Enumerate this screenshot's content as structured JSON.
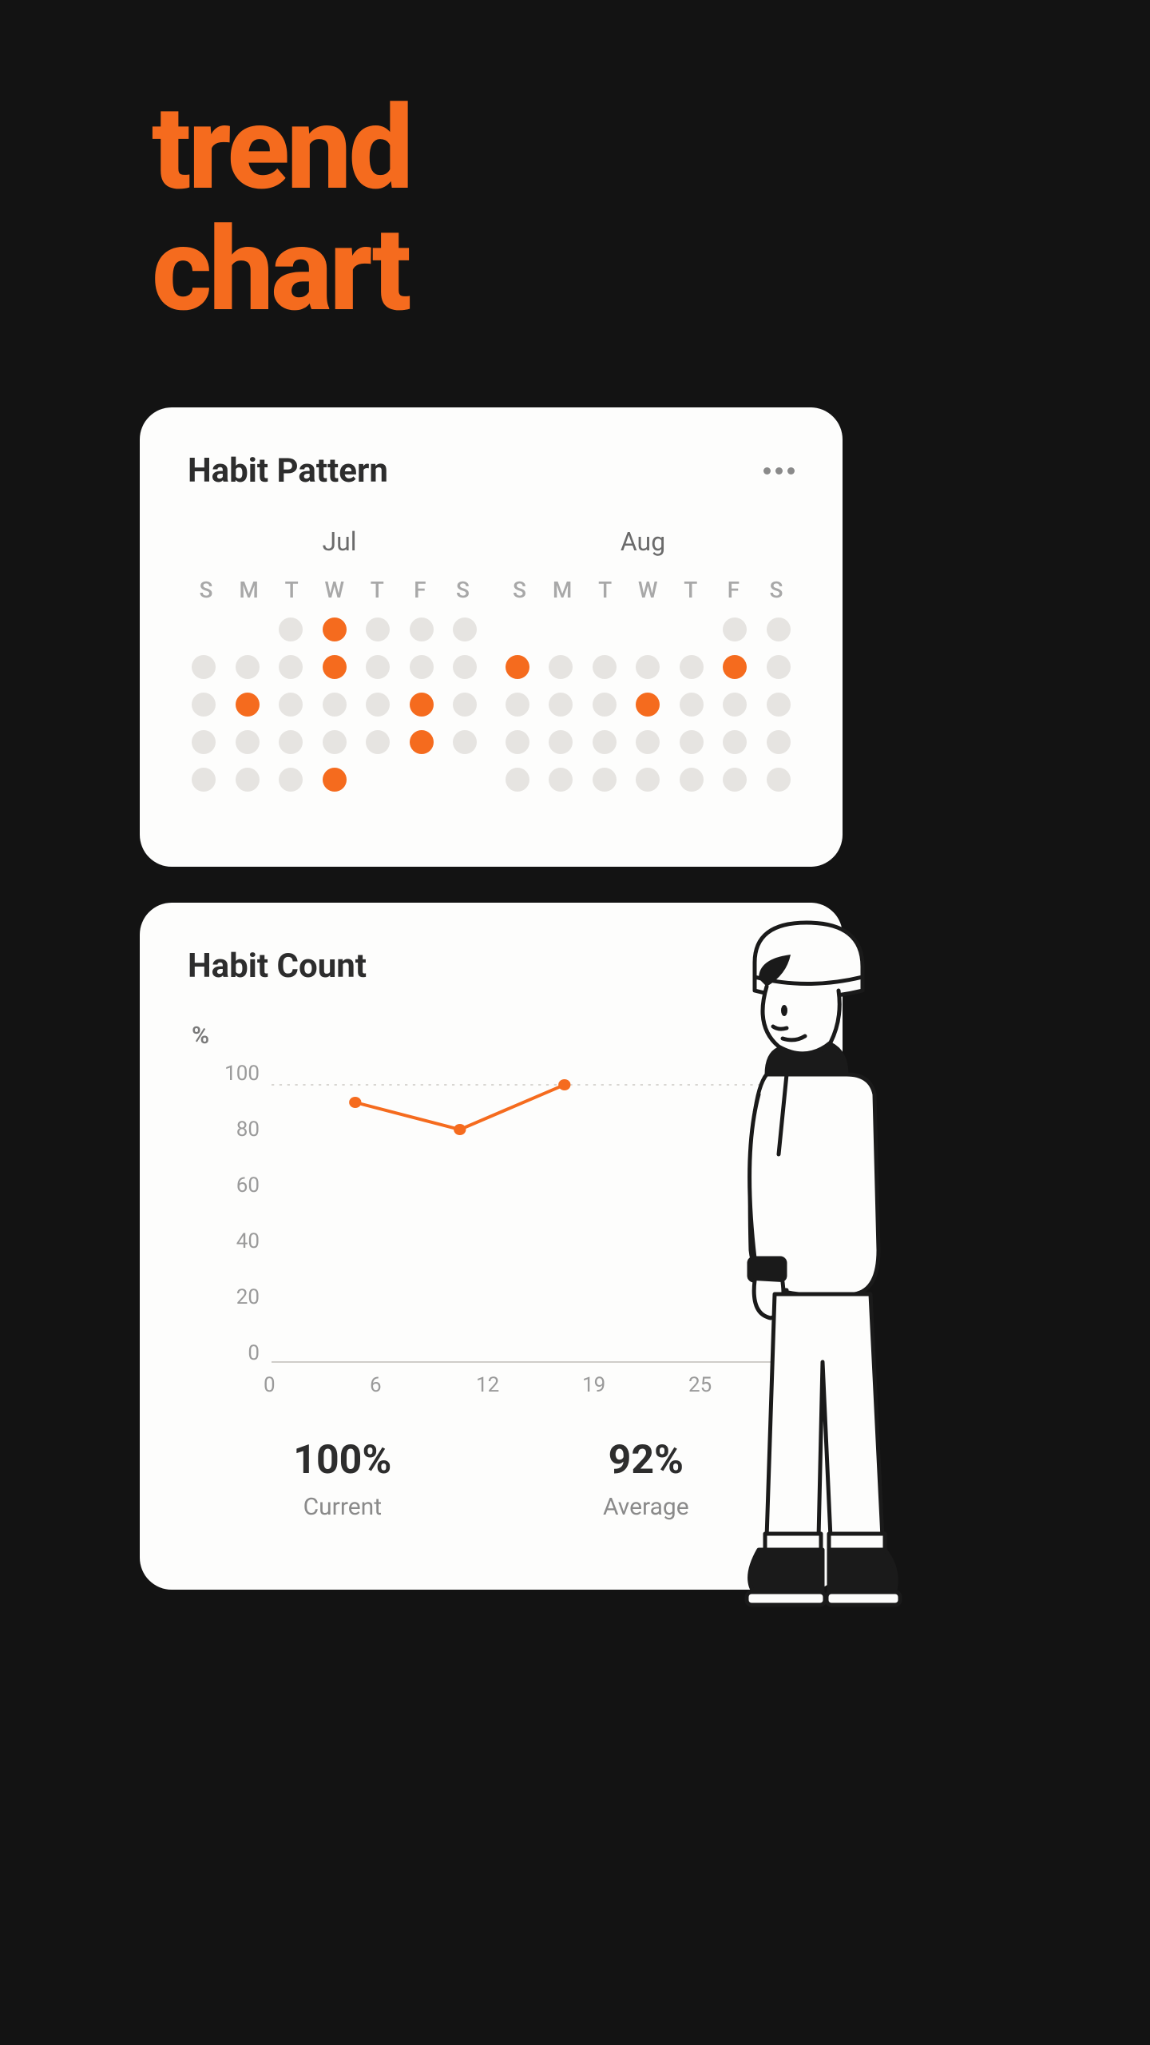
{
  "page": {
    "title_line1": "trend",
    "title_line2": "chart"
  },
  "colors": {
    "accent": "#F56B1E",
    "bg": "#131313",
    "card": "#FDFDFC",
    "dot_off": "#E6E4E1"
  },
  "pattern_card": {
    "title": "Habit Pattern",
    "weekdays": [
      "S",
      "M",
      "T",
      "W",
      "T",
      "F",
      "S"
    ],
    "months": [
      {
        "label": "Jul",
        "grid": [
          [
            "empty",
            "empty",
            "off",
            "on",
            "off",
            "off",
            "off"
          ],
          [
            "off",
            "off",
            "off",
            "on",
            "off",
            "off",
            "off"
          ],
          [
            "off",
            "on",
            "off",
            "off",
            "off",
            "on",
            "off"
          ],
          [
            "off",
            "off",
            "off",
            "off",
            "off",
            "on",
            "off"
          ],
          [
            "off",
            "off",
            "off",
            "on",
            "empty",
            "empty",
            "empty"
          ]
        ]
      },
      {
        "label": "Aug",
        "grid": [
          [
            "empty",
            "empty",
            "empty",
            "empty",
            "empty",
            "off",
            "off"
          ],
          [
            "on",
            "off",
            "off",
            "off",
            "off",
            "on",
            "off"
          ],
          [
            "off",
            "off",
            "off",
            "on",
            "off",
            "off",
            "off"
          ],
          [
            "off",
            "off",
            "off",
            "off",
            "off",
            "off",
            "off"
          ],
          [
            "off",
            "off",
            "off",
            "off",
            "off",
            "off",
            "off"
          ]
        ]
      }
    ]
  },
  "count_card": {
    "title": "Habit Count",
    "unit": "%",
    "y_ticks": [
      "100",
      "80",
      "60",
      "40",
      "20",
      "0"
    ],
    "x_ticks": [
      "0",
      "6",
      "12",
      "19",
      "25"
    ],
    "stats": [
      {
        "value": "100%",
        "label": "Current"
      },
      {
        "value": "92%",
        "label": "Average"
      }
    ]
  },
  "chart_data": {
    "type": "line",
    "title": "Habit Count",
    "ylabel": "%",
    "ylim": [
      0,
      100
    ],
    "x_ticks": [
      0,
      6,
      12,
      19,
      25
    ],
    "series": [
      {
        "name": "Habit Count %",
        "points": [
          {
            "x": 4,
            "y": 94
          },
          {
            "x": 9,
            "y": 85
          },
          {
            "x": 14,
            "y": 100
          }
        ]
      }
    ],
    "summary": {
      "current_pct": 100,
      "average_pct": 92
    }
  }
}
